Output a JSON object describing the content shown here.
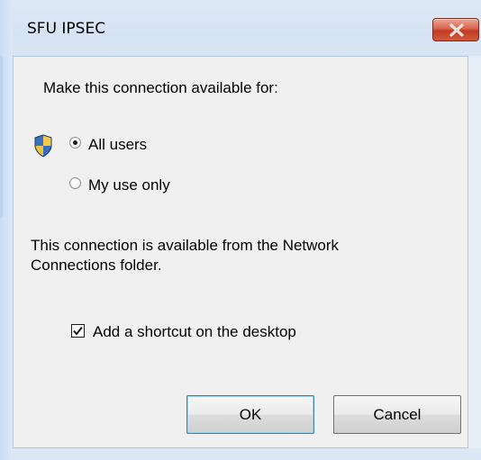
{
  "window": {
    "title": "SFU IPSEC",
    "close_label": "×"
  },
  "dialog": {
    "prompt": "Make this connection available for:",
    "options": [
      {
        "label": "All users",
        "selected": true
      },
      {
        "label": "My use only",
        "selected": false
      }
    ],
    "info_line1": "This connection is available from the Network",
    "info_line2": "Connections folder.",
    "shortcut": {
      "label": "Add a shortcut on the desktop",
      "checked": true
    }
  },
  "buttons": {
    "ok": "OK",
    "cancel": "Cancel"
  },
  "icons": {
    "shield": "uac-shield-icon",
    "close": "close-icon"
  },
  "colors": {
    "close_button": "#c23b22",
    "dialog_bg": "#f0f0f0",
    "frame": "#d6e3f4"
  }
}
